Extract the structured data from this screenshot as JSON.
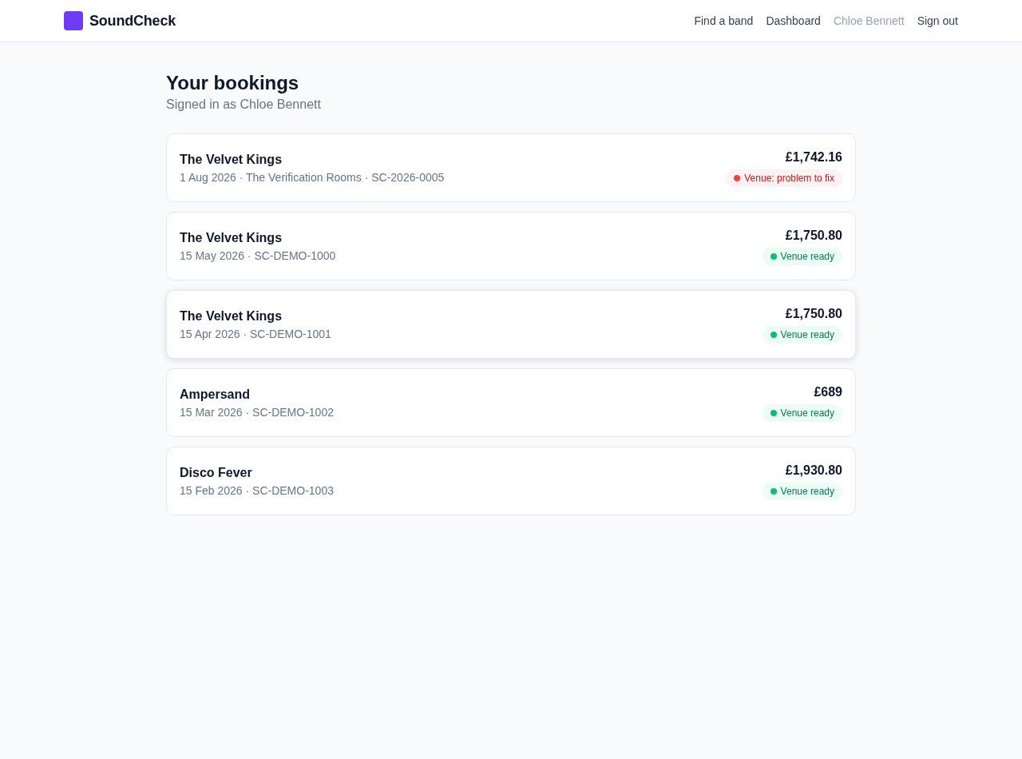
{
  "header": {
    "logo": {
      "text": "SoundCheck"
    },
    "nav": [
      {
        "label": "Find a band",
        "kind": "link"
      },
      {
        "label": "Dashboard",
        "kind": "link"
      },
      {
        "label": "Chloe Bennett",
        "kind": "user"
      },
      {
        "label": "Sign out",
        "kind": "link"
      }
    ]
  },
  "page": {
    "title": "Your bookings",
    "subtitle": "Signed in as Chloe Bennett"
  },
  "bookings": [
    {
      "band": "The Velvet Kings",
      "details": "1 Aug 2026 · The Verification Rooms · SC-2026-0005",
      "price": "£1,742.16",
      "status": {
        "kind": "problem",
        "label": "Venue: problem to fix"
      },
      "highlighted": false
    },
    {
      "band": "The Velvet Kings",
      "details": "15 May 2026 · SC-DEMO-1000",
      "price": "£1,750.80",
      "status": {
        "kind": "ready",
        "label": "Venue ready"
      },
      "highlighted": false
    },
    {
      "band": "The Velvet Kings",
      "details": "15 Apr 2026 · SC-DEMO-1001",
      "price": "£1,750.80",
      "status": {
        "kind": "ready",
        "label": "Venue ready"
      },
      "highlighted": true
    },
    {
      "band": "Ampersand",
      "details": "15 Mar 2026 · SC-DEMO-1002",
      "price": "£689",
      "status": {
        "kind": "ready",
        "label": "Venue ready"
      },
      "highlighted": false
    },
    {
      "band": "Disco Fever",
      "details": "15 Feb 2026 · SC-DEMO-1003",
      "price": "£1,930.80",
      "status": {
        "kind": "ready",
        "label": "Venue ready"
      },
      "highlighted": false
    }
  ]
}
